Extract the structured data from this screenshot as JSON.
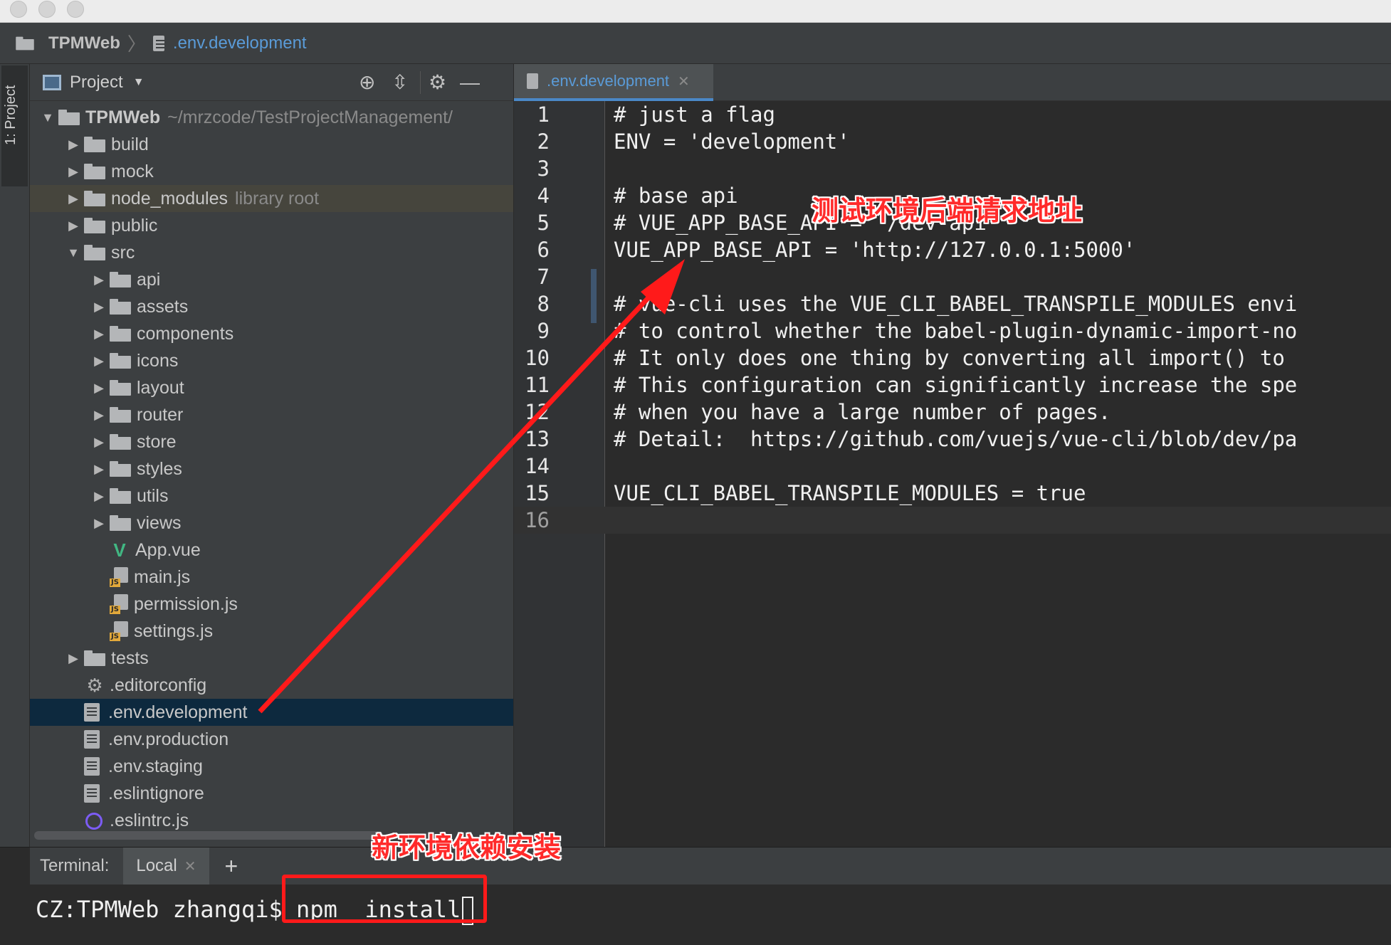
{
  "breadcrumb": {
    "project": "TPMWeb",
    "file": ".env.development"
  },
  "tool_window": {
    "stripe_label": "1: Project"
  },
  "project_panel": {
    "title": "Project",
    "tree": [
      {
        "name": "TPMWeb",
        "extra": "~/mrzcode/TestProjectManagement/",
        "kind": "folder",
        "level": 0,
        "expanded": true
      },
      {
        "name": "build",
        "kind": "folder",
        "level": 1,
        "expanded": false
      },
      {
        "name": "mock",
        "kind": "folder",
        "level": 1,
        "expanded": false
      },
      {
        "name": "node_modules",
        "extra": "library root",
        "kind": "folder",
        "level": 1,
        "expanded": false
      },
      {
        "name": "public",
        "kind": "folder",
        "level": 1,
        "expanded": false
      },
      {
        "name": "src",
        "kind": "folder",
        "level": 1,
        "expanded": true
      },
      {
        "name": "api",
        "kind": "folder",
        "level": 2,
        "expanded": false
      },
      {
        "name": "assets",
        "kind": "folder",
        "level": 2,
        "expanded": false
      },
      {
        "name": "components",
        "kind": "folder",
        "level": 2,
        "expanded": false
      },
      {
        "name": "icons",
        "kind": "folder",
        "level": 2,
        "expanded": false
      },
      {
        "name": "layout",
        "kind": "folder",
        "level": 2,
        "expanded": false
      },
      {
        "name": "router",
        "kind": "folder",
        "level": 2,
        "expanded": false
      },
      {
        "name": "store",
        "kind": "folder",
        "level": 2,
        "expanded": false
      },
      {
        "name": "styles",
        "kind": "folder",
        "level": 2,
        "expanded": false
      },
      {
        "name": "utils",
        "kind": "folder",
        "level": 2,
        "expanded": false
      },
      {
        "name": "views",
        "kind": "folder",
        "level": 2,
        "expanded": false
      },
      {
        "name": "App.vue",
        "kind": "vue",
        "level": 2
      },
      {
        "name": "main.js",
        "kind": "js",
        "level": 2
      },
      {
        "name": "permission.js",
        "kind": "js",
        "level": 2
      },
      {
        "name": "settings.js",
        "kind": "js",
        "level": 2
      },
      {
        "name": "tests",
        "kind": "folder",
        "level": 1,
        "expanded": false
      },
      {
        "name": ".editorconfig",
        "kind": "config",
        "level": 1
      },
      {
        "name": ".env.development",
        "kind": "doc",
        "level": 1
      },
      {
        "name": ".env.production",
        "kind": "doc",
        "level": 1
      },
      {
        "name": ".env.staging",
        "kind": "doc",
        "level": 1
      },
      {
        "name": ".eslintignore",
        "kind": "doc",
        "level": 1
      },
      {
        "name": ".eslintrc.js",
        "kind": "eslint",
        "level": 1
      }
    ]
  },
  "editor": {
    "tab_label": ".env.development",
    "lines": [
      {
        "n": "1",
        "text": "# just a flag"
      },
      {
        "n": "2",
        "text": "ENV = 'development'"
      },
      {
        "n": "3",
        "text": ""
      },
      {
        "n": "4",
        "text": "# base api"
      },
      {
        "n": "5",
        "text": "# VUE_APP_BASE_API = '/dev-api'"
      },
      {
        "n": "6",
        "text": "VUE_APP_BASE_API = 'http://127.0.0.1:5000'"
      },
      {
        "n": "7",
        "text": ""
      },
      {
        "n": "8",
        "text": "# vue-cli uses the VUE_CLI_BABEL_TRANSPILE_MODULES envi"
      },
      {
        "n": "9",
        "text": "# to control whether the babel-plugin-dynamic-import-no"
      },
      {
        "n": "10",
        "text": "# It only does one thing by converting all import() to"
      },
      {
        "n": "11",
        "text": "# This configuration can significantly increase the spe"
      },
      {
        "n": "12",
        "text": "# when you have a large number of pages."
      },
      {
        "n": "13",
        "text": "# Detail:  https://github.com/vuejs/vue-cli/blob/dev/pa"
      },
      {
        "n": "14",
        "text": ""
      },
      {
        "n": "15",
        "text": "VUE_CLI_BABEL_TRANSPILE_MODULES = true"
      },
      {
        "n": "16",
        "text": ""
      }
    ]
  },
  "terminal": {
    "label": "Terminal:",
    "tab": "Local",
    "add": "+",
    "prompt": "CZ:TPMWeb zhangqi$ npm  install"
  },
  "annotations": {
    "backend_note": "测试环境后端请求地址",
    "install_note": "新环境依赖安装",
    "color": "#ff1a1a"
  }
}
